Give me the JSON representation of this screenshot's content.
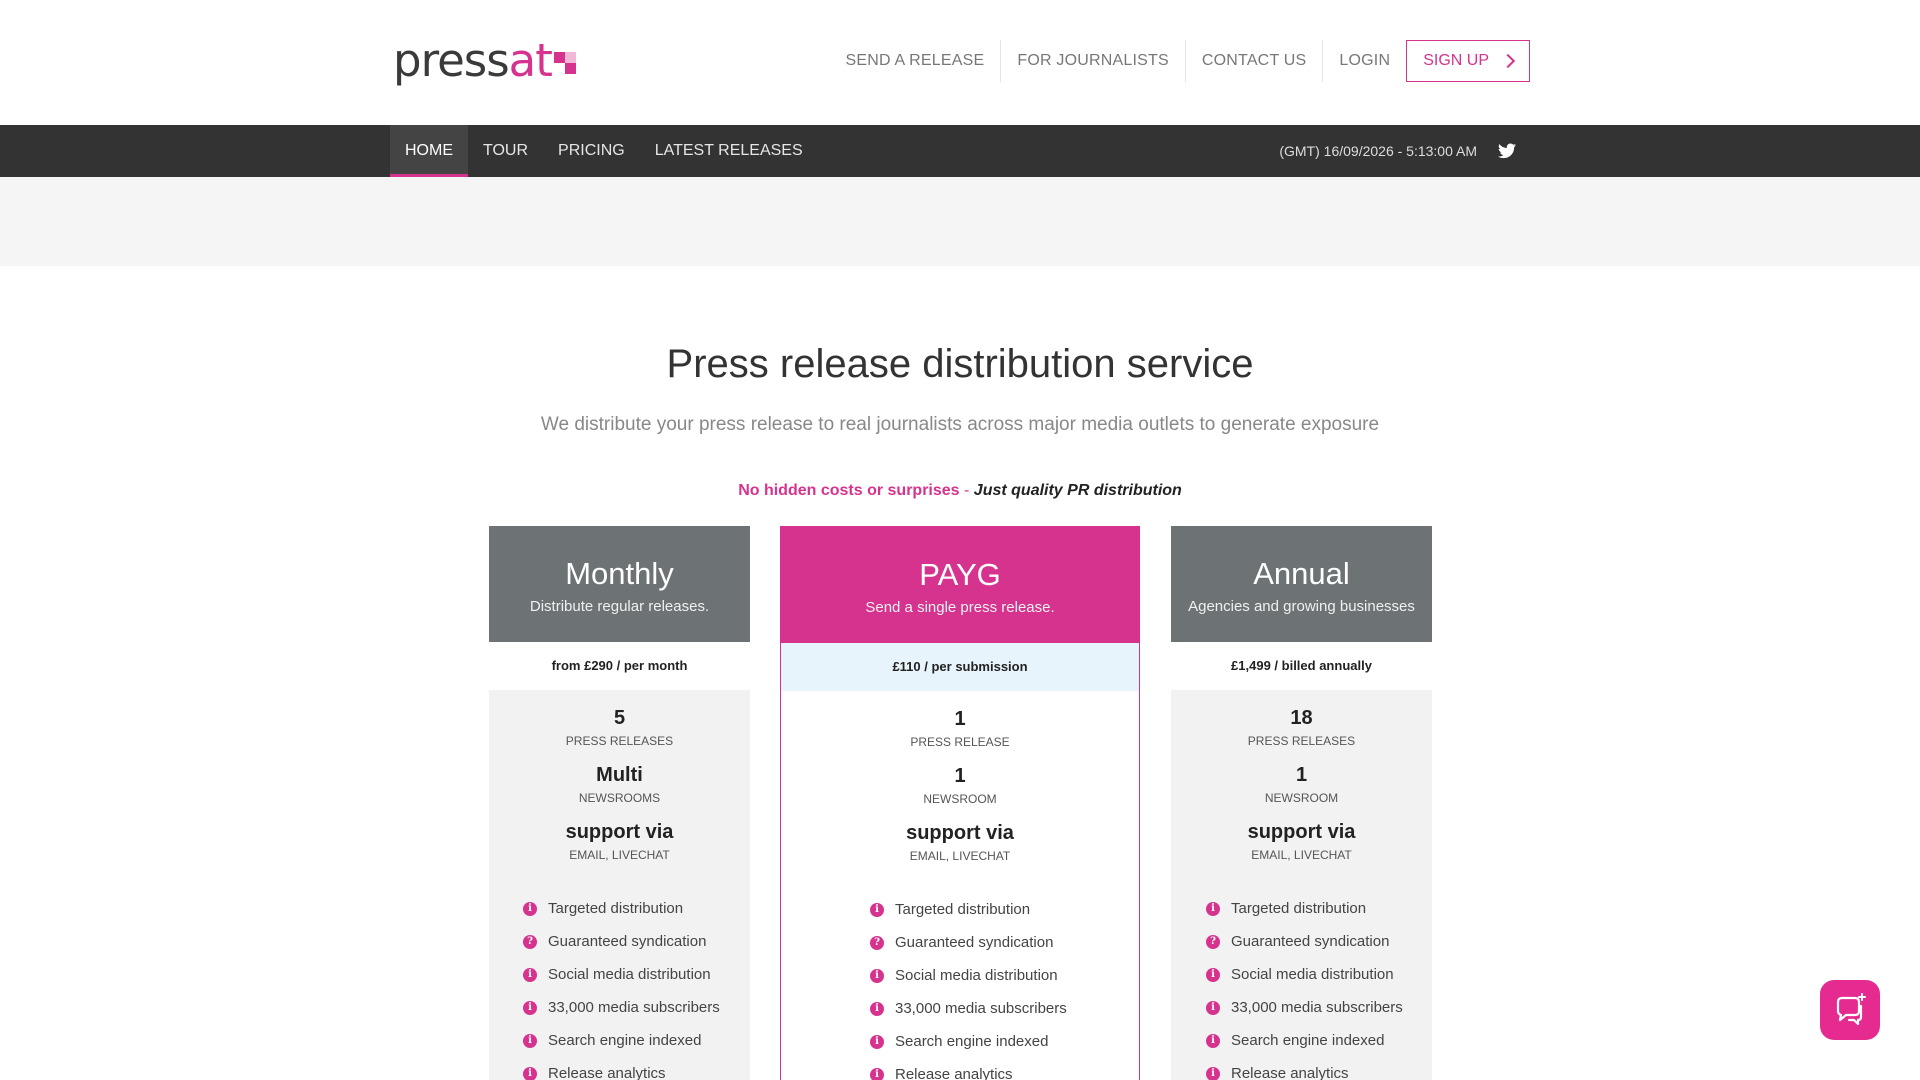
{
  "logo": {
    "text_press": "press",
    "text_at": "at"
  },
  "topnav": {
    "items": [
      "SEND A RELEASE",
      "FOR JOURNALISTS",
      "CONTACT US",
      "LOGIN"
    ],
    "signup_label": "SIGN UP"
  },
  "mainnav": {
    "items": [
      "HOME",
      "TOUR",
      "PRICING",
      "LATEST RELEASES"
    ],
    "active": "HOME",
    "clock": "(GMT) 16/09/2026 - 5:13:00 AM"
  },
  "hero": {
    "title": "Press release distribution service",
    "subtitle": "We distribute your press release to real journalists across major media outlets to generate exposure",
    "tagline_pink": "No hidden costs or surprises",
    "tagline_dash": " - ",
    "tagline_em": "Just quality PR distribution"
  },
  "plans": [
    {
      "name": "Monthly",
      "desc": "Distribute regular releases.",
      "price": "from £290 / per month",
      "stats": [
        {
          "num": "5",
          "label": "PRESS RELEASES"
        },
        {
          "num": "Multi",
          "label": "NEWSROOMS"
        },
        {
          "num": "support via",
          "label": "EMAIL, LIVECHAT"
        }
      ],
      "features": [
        "Targeted distribution",
        "Guaranteed syndication",
        "Social media distribution",
        "33,000 media subscribers",
        "Search engine indexed",
        "Release analytics"
      ]
    },
    {
      "name": "PAYG",
      "desc": "Send a single press release.",
      "price": "£110 / per submission",
      "stats": [
        {
          "num": "1",
          "label": "PRESS RELEASE"
        },
        {
          "num": "1",
          "label": "NEWSROOM"
        },
        {
          "num": "support via",
          "label": "EMAIL, LIVECHAT"
        }
      ],
      "features": [
        "Targeted distribution",
        "Guaranteed syndication",
        "Social media distribution",
        "33,000 media subscribers",
        "Search engine indexed",
        "Release analytics"
      ]
    },
    {
      "name": "Annual",
      "desc": "Agencies and growing businesses",
      "price": "£1,499 / billed annually",
      "stats": [
        {
          "num": "18",
          "label": "PRESS RELEASES"
        },
        {
          "num": "1",
          "label": "NEWSROOM"
        },
        {
          "num": "support via",
          "label": "EMAIL, LIVECHAT"
        }
      ],
      "features": [
        "Targeted distribution",
        "Guaranteed syndication",
        "Social media distribution",
        "33,000 media subscribers",
        "Search engine indexed",
        "Release analytics"
      ]
    }
  ],
  "feature_icons": [
    "i",
    "?",
    "i",
    "i",
    "i",
    "i"
  ],
  "icons": {
    "twitter": "twitter-icon",
    "chat": "chat-icon",
    "chevron": "chevron-right-icon"
  },
  "colors": {
    "brand": "#d6338f",
    "nav_bg": "#333333",
    "plan_head": "#6d7275"
  }
}
